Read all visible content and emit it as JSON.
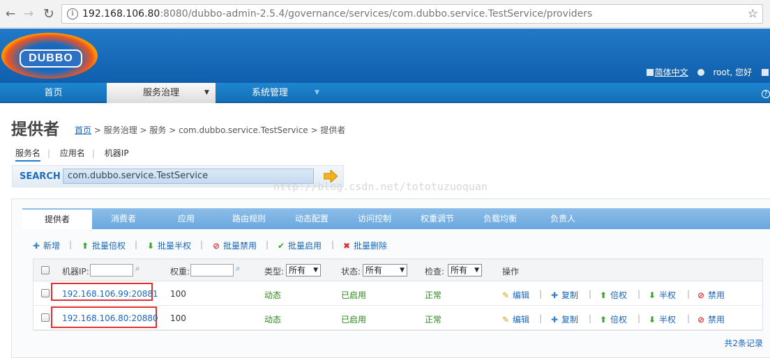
{
  "browser": {
    "url_host": "192.168.106.80",
    "url_rest": ":8080/dubbo-admin-2.5.4/governance/services/com.dubbo.service.TestService/providers",
    "back": "←",
    "forward": "→",
    "reload": "↻",
    "info": "i",
    "star": "☆"
  },
  "header": {
    "logo": "DUBBO",
    "lang_link": "简体中文",
    "user_text": "root, 您好"
  },
  "nav": {
    "items": [
      {
        "label": "首页"
      },
      {
        "label": "服务治理"
      },
      {
        "label": "系统管理"
      }
    ],
    "help": "?"
  },
  "page": {
    "title": "提供者",
    "breadcrumb": {
      "home": "首页",
      "rest": " > 服务治理 > 服务 > com.dubbo.service.TestService > 提供者"
    }
  },
  "search": {
    "tabs": [
      "服务名",
      "应用名",
      "机器IP"
    ],
    "label": "SEARCH",
    "value": "com.dubbo.service.TestService",
    "watermark": "http://blog.csdn.net/tototuzuoquan"
  },
  "tabs": [
    "提供者",
    "消费者",
    "应用",
    "路由规则",
    "动态配置",
    "访问控制",
    "权重调节",
    "负载均衡",
    "负责人"
  ],
  "actions": [
    {
      "icon": "✚",
      "label": "新增"
    },
    {
      "icon": "⬆",
      "label": "批量倍权"
    },
    {
      "icon": "⬇",
      "label": "批量半权"
    },
    {
      "icon": "⊘",
      "label": "批量禁用"
    },
    {
      "icon": "✔",
      "label": "批量启用"
    },
    {
      "icon": "✖",
      "label": "批量删除"
    }
  ],
  "table": {
    "headers": {
      "ip": "机器IP:",
      "weight": "权重:",
      "type": "类型:",
      "type_value": "所有",
      "status": "状态:",
      "status_value": "所有",
      "check": "检查:",
      "check_value": "所有",
      "ops": "操作"
    },
    "rows": [
      {
        "ip": "192.168.106.99:20881",
        "weight": "100",
        "type": "动态",
        "status": "已启用",
        "check": "正常"
      },
      {
        "ip": "192.168.106.80:20880",
        "weight": "100",
        "type": "动态",
        "status": "已启用",
        "check": "正常"
      }
    ],
    "ops": [
      {
        "icon": "✎",
        "label": "编辑"
      },
      {
        "icon": "✚",
        "label": "复制"
      },
      {
        "icon": "⬆",
        "label": "倍权"
      },
      {
        "icon": "⬇",
        "label": "半权"
      },
      {
        "icon": "⊘",
        "label": "禁用"
      }
    ]
  },
  "total": "共2条记录",
  "colors": {
    "header_blue": "#1565b4",
    "link_blue": "#1a66b8",
    "status_green": "#2a8a17",
    "highlight_red": "#e03030"
  }
}
